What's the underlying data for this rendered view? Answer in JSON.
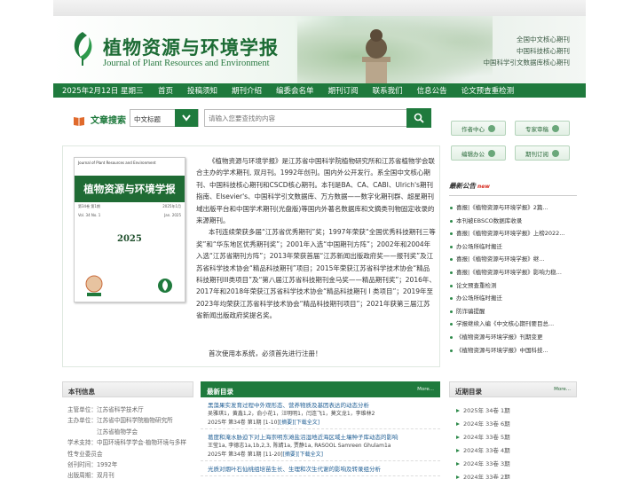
{
  "header": {
    "title": "植物资源与环境学报",
    "subtitle": "Journal of Plant Resources and Environment",
    "badges": [
      "全国中文核心期刊",
      "中国科技核心期刊",
      "中国科学引文数据库核心期刊"
    ]
  },
  "nav": {
    "date": "2025年2月12日 星期三",
    "items": [
      "首页",
      "投稿须知",
      "期刊介绍",
      "编委会名单",
      "期刊订阅",
      "联系我们",
      "信息公告",
      "论文预查重检测"
    ]
  },
  "search": {
    "label": "文章搜索",
    "select_value": "中文标题",
    "keyword_placeholder": "请输入您要查找的内容"
  },
  "quick_links": [
    "作者中心",
    "专家审稿",
    "编辑办公",
    "期刊订阅"
  ],
  "cover": {
    "journal_en": "Journal of Plant Resources and Environment",
    "journal_cn": "植物资源与环境学报",
    "vol": "Vol. 34  No. 1",
    "date": "Jan. 2025",
    "vol_cn": "第34卷 第1期",
    "date_cn": "2025年1月",
    "year": "2025"
  },
  "intro": {
    "p1": "《植物资源与环境学报》是江苏省中国科学院植物研究所和江苏省植物学会联合主办的学术期刊, 双月刊。1992年创刊。国内外公开发行。系全国中文核心期刊、中国科技核心期刊和CSCD核心期刊。本刊是BA、CA、CABI、Ulrich's期刊指南、Elsevier's、中国科学引文数据库、万方数据——数字化期刊群、超星期刊域出版平台和中国学术期刊(光盘版)等国内外著名数据库和文摘类刊物固定收录的来源期刊。",
    "p2": "本刊连续荣获多届“江苏省优秀期刊”奖；1997年荣获“全国优秀科技期刊三等奖”和“华东地区优秀期刊奖”；2001年入选“中国期刊方阵”；2002年和2004年入选“江苏省期刊方阵”；2013年荣获首届“江苏新闻出版政府奖——报刊奖”及江苏省科学技术协会“精品科技期刊”项目；2015年荣获江苏省科学技术协会“精品科技期刊III类项目”及“第八届江苏省科技期刊金马奖——精品期刊奖”；2016年、2017年和2018年荣获江苏省科学技术协会“精品科技期刊 I 类项目”；2019年至2023年均荣获江苏省科学技术协会“精品科技期刊项目”；2021年获第三届江苏省新闻出版政府奖提名奖。",
    "welcome": "首次使用本系统，必须首先进行注册！"
  },
  "notices": {
    "title": "最新公告",
    "new_tag": "new",
    "items": [
      "喜报|《植物资源与环境学报》2篇...",
      "本刊被EBSCO数据库收录",
      "喜报|《植物资源与环境学报》上榜2022...",
      "办公场所临时搬迁",
      "喜报|《植物资源与环境学报》继...",
      "喜报|《植物资源与环境学报》影响力稳...",
      "论文预查重检测",
      "办公场所临时搬迁",
      "防诈骗提醒",
      "学报继续入编《中文核心期刊要目总...",
      "《植物资源与环境学报》刊期变更",
      "《植物资源与环境学报》中国科技..."
    ]
  },
  "journal_info": {
    "title": "本刊信息",
    "lines": [
      "主管单位：江苏省科学技术厅",
      "主办单位：江苏省中国科学院植物研究所",
      "　　　　　江苏省植物学会",
      "学术支持：中国环境科学学会·植物环境与多样性专业委员会",
      "创刊时间：1992年",
      "出版周期：双月刊"
    ]
  },
  "latest": {
    "title": "最新目录",
    "more": "More...",
    "articles": [
      {
        "title": "黑藻果实发育过程中外观形态、营养物质及基因表达的动态分析",
        "authors": "吴雅琪1，黄鑫1,2，俞小花1，汪明明1，闫连飞1，莫文龙1，李维林2",
        "meta": "2025年 第34卷 第1期 [1-10]",
        "links": "[摘要][下载全文]"
      },
      {
        "title": "葛度和淹水胁迫下对上海崇明东滩盐沼湿地近海区域土壤种子库动态的影响",
        "authors": "王莹1a, 李德志1a,1b,2,3, 陈婧1a, 贾静1a, RASOOL Samreen Ghulam1a",
        "meta": "2025年 第34卷 第1期 [11-20]",
        "links": "[摘要][下载全文]"
      },
      {
        "title": "光质对烟叶石仙桃组培苗生长、生理和次生代谢的影响及转录组分析",
        "authors": "",
        "meta": "",
        "links": ""
      }
    ]
  },
  "recent_issues": {
    "title": "近期目录",
    "more": "More...",
    "items": [
      "2025年 34卷 1期",
      "2024年 33卷 6期",
      "2024年 33卷 5期",
      "2024年 33卷 4期",
      "2024年 33卷 3期",
      "2024年 33卷 2期"
    ]
  },
  "colors": {
    "brand_green": "#1f7a3d",
    "link_blue": "#1f5e94",
    "new_red": "#d62a1f"
  }
}
